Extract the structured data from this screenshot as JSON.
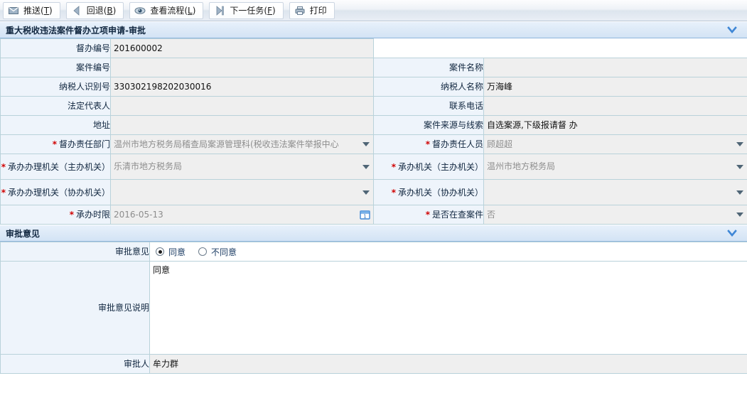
{
  "toolbar": {
    "buttons": [
      {
        "icon": "envelope-icon",
        "name": "push-button",
        "label": "推送(",
        "accel": "T",
        "label_end": ")"
      },
      {
        "icon": "triangle-left-icon",
        "name": "rollback-button",
        "label": "回退(",
        "accel": "B",
        "label_end": ")"
      },
      {
        "icon": "eye-icon",
        "name": "view-flow-button",
        "label": "查看流程(",
        "accel": "L",
        "label_end": ")"
      },
      {
        "icon": "skip-next-icon",
        "name": "next-task-button",
        "label": "下一任务(",
        "accel": "F",
        "label_end": ")"
      },
      {
        "icon": "printer-icon",
        "name": "print-button",
        "label": "打印",
        "accel": "",
        "label_end": ""
      }
    ]
  },
  "sections": {
    "main": {
      "title": "重大税收违法案件督办立项申请-审批",
      "collapse_icon": "chevron-down-icon"
    },
    "approval": {
      "title": "审批意见",
      "collapse_icon": "chevron-down-icon"
    }
  },
  "form": {
    "supervision_no": {
      "label": "督办编号",
      "value": "201600002"
    },
    "case_no": {
      "label": "案件编号",
      "value": ""
    },
    "case_name": {
      "label": "案件名称",
      "value": ""
    },
    "taxpayer_id": {
      "label": "纳税人识别号",
      "value": "330302198202030016"
    },
    "taxpayer_name": {
      "label": "纳税人名称",
      "value": "万海峰"
    },
    "legal_rep": {
      "label": "法定代表人",
      "value": ""
    },
    "contact_phone": {
      "label": "联系电话",
      "value": ""
    },
    "address": {
      "label": "地址",
      "value": ""
    },
    "case_source": {
      "label": "案件来源与线索",
      "value": "自选案源,下级报请督 办"
    },
    "resp_dept": {
      "label": "督办责任部门",
      "value": "温州市地方税务局稽查局案源管理科(税收违法案件举报中心",
      "required": true
    },
    "resp_person": {
      "label": "督办责任人员",
      "value": "顾超超",
      "required": true
    },
    "handling_org_main": {
      "label": "承办办理机关（主办机关）",
      "value": "乐清市地方税务局",
      "required": true
    },
    "org_main": {
      "label": "承办机关（主办机关）",
      "value": "温州市地方税务局",
      "required": true
    },
    "handling_org_assist": {
      "label": "承办办理机关（协办机关）",
      "value": "",
      "required": true
    },
    "org_assist": {
      "label": "承办机关（协办机关）",
      "value": "",
      "required": true
    },
    "deadline": {
      "label": "承办时限",
      "value": "2016-05-13",
      "required": true,
      "icon": "calendar-icon"
    },
    "under_investigation": {
      "label": "是否在查案件",
      "value": "否",
      "required": true
    }
  },
  "approval": {
    "opinion": {
      "label": "审批意见",
      "options": [
        {
          "label": "同意",
          "selected": true
        },
        {
          "label": "不同意",
          "selected": false
        }
      ]
    },
    "comment": {
      "label": "审批意见说明",
      "value": "同意"
    },
    "approver": {
      "label": "审批人",
      "value": "牟力群"
    }
  }
}
